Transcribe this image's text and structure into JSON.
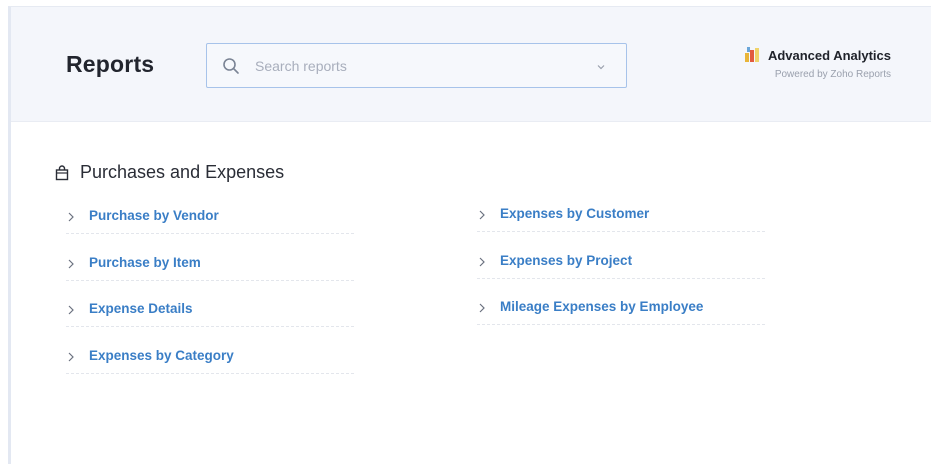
{
  "header": {
    "title": "Reports",
    "search": {
      "placeholder": "Search reports",
      "value": ""
    },
    "analytics": {
      "title": "Advanced Analytics",
      "subtitle": "Powered by Zoho Reports"
    }
  },
  "section": {
    "title": "Purchases and Expenses",
    "left_items": [
      {
        "label": "Purchase by Vendor"
      },
      {
        "label": "Purchase by Item"
      },
      {
        "label": "Expense Details"
      },
      {
        "label": "Expenses by Category"
      }
    ],
    "right_items": [
      {
        "label": "Expenses by Customer"
      },
      {
        "label": "Expenses by Project"
      },
      {
        "label": "Mileage Expenses by Employee"
      }
    ]
  },
  "colors": {
    "link": "#3a7ec6",
    "header_bg": "#f4f6fb",
    "search_border": "#a7c3ea"
  },
  "icons": [
    "search-icon",
    "chevron-down-icon",
    "analytics-logo-icon",
    "shopping-bag-icon",
    "chevron-right-icon"
  ]
}
